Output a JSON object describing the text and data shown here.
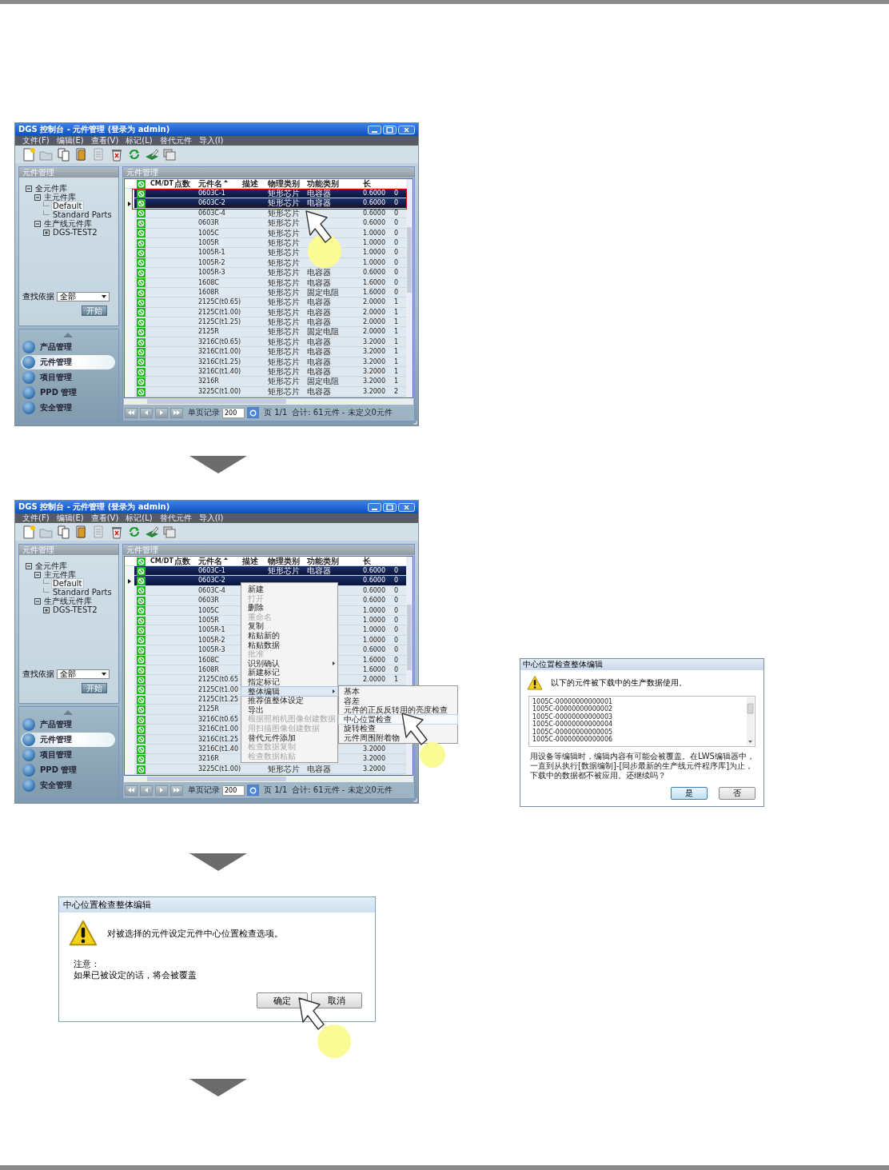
{
  "screens": [
    {
      "title": "DGS 控制台 - 元件管理 (登录为 admin)",
      "menu": [
        "文件(F)",
        "编辑(E)",
        "查看(V)",
        "标记(L)",
        "替代元件",
        "导入(I)"
      ],
      "left_panel": {
        "title": "元件管理",
        "tree": [
          {
            "label": "全元件库",
            "expanded": true,
            "selected": false,
            "children": [
              {
                "label": "主元件库",
                "expanded": true,
                "selected": false,
                "children": [
                  {
                    "label": "Default",
                    "selected": true
                  },
                  {
                    "label": "Standard Parts",
                    "selected": false
                  }
                ]
              },
              {
                "label": "生产线元件库",
                "expanded": true,
                "selected": false,
                "children": [
                  {
                    "label": "DGS-TEST2",
                    "expanded": false,
                    "selected": false
                  }
                ]
              }
            ]
          }
        ],
        "search_label": "查找依据",
        "search_value": "全部",
        "start_button": "开始",
        "nav": [
          {
            "label": "产品管理",
            "selected": false
          },
          {
            "label": "元件管理",
            "selected": true
          },
          {
            "label": "项目管理",
            "selected": false
          },
          {
            "label": "PPD 管理",
            "selected": false
          },
          {
            "label": "安全管理",
            "selected": false
          }
        ]
      },
      "table": {
        "title": "元件管理",
        "columns": [
          "CM/DT",
          "点数",
          "元件名",
          "描述",
          "物理类别",
          "功能类别",
          "长"
        ],
        "rows": [
          {
            "name": "0603C-1",
            "physical": "矩形芯片",
            "function": "电容器",
            "length": "0.6000",
            "column_9": "0",
            "selected": true,
            "current": false
          },
          {
            "name": "0603C-2",
            "physical": "矩形芯片",
            "function": "电容器",
            "length": "0.6000",
            "column_9": "0",
            "selected": true,
            "current": true
          },
          {
            "name": "0603C-4",
            "physical": "矩形芯片",
            "length": "0.6000",
            "column_9": "0",
            "selected": false,
            "current": false
          },
          {
            "name": "0603R",
            "physical": "矩形芯片",
            "length": "0.6000",
            "column_9": "0",
            "selected": false,
            "current": false
          },
          {
            "name": "1005C",
            "physical": "矩形芯片",
            "length": "1.0000",
            "column_9": "0",
            "selected": false,
            "current": false
          },
          {
            "name": "1005R",
            "physical": "矩形芯片",
            "length": "1.0000",
            "column_9": "0",
            "selected": false,
            "current": false
          },
          {
            "name": "1005R-1",
            "physical": "矩形芯片",
            "length": "1.0000",
            "column_9": "0",
            "selected": false,
            "current": false
          },
          {
            "name": "1005R-2",
            "physical": "矩形芯片",
            "length": "1.0000",
            "column_9": "0",
            "selected": false,
            "current": false
          },
          {
            "name": "1005R-3",
            "physical": "矩形芯片",
            "function": "电容器",
            "length": "0.6000",
            "column_9": "0",
            "selected": false,
            "current": false
          },
          {
            "name": "1608C",
            "physical": "矩形芯片",
            "function": "电容器",
            "length": "1.6000",
            "column_9": "0",
            "selected": false,
            "current": false
          },
          {
            "name": "1608R",
            "physical": "矩形芯片",
            "function": "固定电阻",
            "length": "1.6000",
            "column_9": "0",
            "selected": false,
            "current": false
          },
          {
            "name": "2125C(t0.65)",
            "physical": "矩形芯片",
            "function": "电容器",
            "length": "2.0000",
            "column_9": "1",
            "selected": false,
            "current": false
          },
          {
            "name": "2125C(t1.00)",
            "physical": "矩形芯片",
            "function": "电容器",
            "length": "2.0000",
            "column_9": "1",
            "selected": false,
            "current": false
          },
          {
            "name": "2125C(t1.25)",
            "physical": "矩形芯片",
            "function": "电容器",
            "length": "2.0000",
            "column_9": "1",
            "selected": false,
            "current": false
          },
          {
            "name": "2125R",
            "physical": "矩形芯片",
            "function": "固定电阻",
            "length": "2.0000",
            "column_9": "1",
            "selected": false,
            "current": false
          },
          {
            "name": "3216C(t0.65)",
            "physical": "矩形芯片",
            "function": "电容器",
            "length": "3.2000",
            "column_9": "1",
            "selected": false,
            "current": false
          },
          {
            "name": "3216C(t1.00)",
            "physical": "矩形芯片",
            "function": "电容器",
            "length": "3.2000",
            "column_9": "1",
            "selected": false,
            "current": false
          },
          {
            "name": "3216C(t1.25)",
            "physical": "矩形芯片",
            "function": "电容器",
            "length": "3.2000",
            "column_9": "1",
            "selected": false,
            "current": false
          },
          {
            "name": "3216C(t1.40)",
            "physical": "矩形芯片",
            "function": "电容器",
            "length": "3.2000",
            "column_9": "1",
            "selected": false,
            "current": false
          },
          {
            "name": "3216R",
            "physical": "矩形芯片",
            "function": "固定电阻",
            "length": "3.2000",
            "column_9": "1",
            "selected": false,
            "current": false
          },
          {
            "name": "3225C(t1.00)",
            "physical": "矩形芯片",
            "function": "电容器",
            "length": "3.2000",
            "column_9": "2",
            "selected": false,
            "current": false
          }
        ]
      },
      "pager": {
        "page_size_label": "单页记录",
        "page_size": "200",
        "page": "页 1/1",
        "total": "合计: 61元件 - 未定义0元件"
      }
    },
    {
      "title": "DGS 控制台 - 元件管理 (登录为 admin)",
      "menu": [
        "文件(F)",
        "编辑(E)",
        "查看(V)",
        "标记(L)",
        "替代元件",
        "导入(I)"
      ],
      "left_panel": {
        "title": "元件管理",
        "tree": [
          {
            "label": "全元件库",
            "expanded": true,
            "selected": false,
            "children": [
              {
                "label": "主元件库",
                "expanded": true,
                "selected": false,
                "children": [
                  {
                    "label": "Default",
                    "selected": true
                  },
                  {
                    "label": "Standard Parts",
                    "selected": false
                  }
                ]
              },
              {
                "label": "生产线元件库",
                "expanded": true,
                "selected": false,
                "children": [
                  {
                    "label": "DGS-TEST2",
                    "expanded": false,
                    "selected": false
                  }
                ]
              }
            ]
          }
        ],
        "search_label": "查找依据",
        "search_value": "全部",
        "start_button": "开始",
        "nav": [
          {
            "label": "产品管理",
            "selected": false
          },
          {
            "label": "元件管理",
            "selected": true
          },
          {
            "label": "项目管理",
            "selected": false
          },
          {
            "label": "PPD 管理",
            "selected": false
          },
          {
            "label": "安全管理",
            "selected": false
          }
        ]
      },
      "table": {
        "title": "元件管理",
        "columns": [
          "CM/DT",
          "点数",
          "元件名",
          "描述",
          "物理类别",
          "功能类别",
          "长"
        ],
        "rows": [
          {
            "name": "0603C-1",
            "physical": "矩形芯片",
            "function": "电容器",
            "length": "0.6000",
            "column_9": "0",
            "selected": true,
            "current": false
          },
          {
            "name": "0603C-2",
            "length": "0.6000",
            "column_9": "0",
            "selected": true,
            "current": true
          },
          {
            "name": "0603C-4",
            "length": "0.6000",
            "column_9": "0",
            "selected": false,
            "current": false
          },
          {
            "name": "0603R",
            "length": "0.6000",
            "column_9": "0",
            "selected": false,
            "current": false
          },
          {
            "name": "1005C",
            "length": "1.0000",
            "column_9": "0",
            "selected": false,
            "current": false
          },
          {
            "name": "1005R",
            "length": "1.0000",
            "column_9": "0",
            "selected": false,
            "current": false
          },
          {
            "name": "1005R-1",
            "length": "1.0000",
            "column_9": "0",
            "selected": false,
            "current": false
          },
          {
            "name": "1005R-2",
            "length": "1.0000",
            "column_9": "0",
            "selected": false,
            "current": false
          },
          {
            "name": "1005R-3",
            "length": "0.6000",
            "column_9": "0",
            "selected": false,
            "current": false
          },
          {
            "name": "1608C",
            "length": "1.6000",
            "column_9": "0",
            "selected": false,
            "current": false
          },
          {
            "name": "1608R",
            "length": "1.6000",
            "column_9": "0",
            "selected": false,
            "current": false
          },
          {
            "name": "2125C(t0.65",
            "length": "2.0000",
            "column_9": "1",
            "selected": false,
            "current": false
          },
          {
            "name": "2125C(t1.00",
            "selected": false,
            "current": false
          },
          {
            "name": "2125C(t1.25",
            "selected": false,
            "current": false
          },
          {
            "name": "2125R",
            "selected": false,
            "current": false
          },
          {
            "name": "3216C(t0.65",
            "selected": false,
            "current": false
          },
          {
            "name": "3216C(t1.00",
            "selected": false,
            "current": false
          },
          {
            "name": "3216C(t1.25",
            "selected": false,
            "current": false
          },
          {
            "name": "3216C(t1.40",
            "length": "3.2000",
            "selected": false,
            "current": false
          },
          {
            "name": "3216R",
            "length": "3.2000",
            "selected": false,
            "current": false
          },
          {
            "name": "3225C(t1.00)",
            "physical": "矩形芯片",
            "function": "电容器",
            "length": "3.2000",
            "selected": false,
            "current": false
          }
        ]
      },
      "pager": {
        "page_size_label": "单页记录",
        "page_size": "200",
        "page": "页 1/1",
        "total": "合计: 61元件 - 未定义0元件"
      },
      "context_menu": {
        "items": [
          {
            "label": "新建",
            "disabled": false,
            "has_submenu": false,
            "selected": false
          },
          {
            "label": "打开",
            "disabled": true,
            "has_submenu": false,
            "selected": false
          },
          {
            "label": "删除",
            "disabled": false,
            "has_submenu": false,
            "selected": false
          },
          {
            "label": "重命名",
            "disabled": true,
            "has_submenu": false,
            "selected": false
          },
          {
            "label": "复制",
            "disabled": false,
            "has_submenu": false,
            "selected": false
          },
          {
            "label": "粘贴新的",
            "disabled": false,
            "has_submenu": false,
            "selected": false
          },
          {
            "label": "粘贴数据",
            "disabled": false,
            "has_submenu": false,
            "selected": false
          },
          {
            "label": "批准",
            "disabled": true,
            "has_submenu": false,
            "selected": false
          },
          {
            "label": "识别确认",
            "disabled": false,
            "has_submenu": true,
            "selected": false
          },
          {
            "label": "新建标记",
            "disabled": false,
            "has_submenu": false,
            "selected": false
          },
          {
            "label": "指定标记",
            "disabled": false,
            "has_submenu": false,
            "selected": false
          },
          {
            "label": "整体编辑",
            "disabled": false,
            "has_submenu": true,
            "selected": true
          },
          {
            "label": "推荐值整体设定",
            "disabled": false,
            "has_submenu": false,
            "selected": false
          },
          {
            "label": "导出",
            "disabled": false,
            "has_submenu": false,
            "selected": false
          },
          {
            "label": "根据照相机图像创建数据",
            "disabled": true,
            "has_submenu": false,
            "selected": false
          },
          {
            "label": "用扫描图像创建数据",
            "disabled": true,
            "has_submenu": false,
            "selected": false
          },
          {
            "label": "替代元件添加",
            "disabled": false,
            "has_submenu": false,
            "selected": false
          },
          {
            "label": "检查数据复制",
            "disabled": true,
            "has_submenu": false,
            "selected": false
          },
          {
            "label": "检查数据粘贴",
            "disabled": true,
            "has_submenu": false,
            "selected": false
          }
        ],
        "submenu": [
          {
            "label": "基本",
            "selected": false
          },
          {
            "label": "容差",
            "selected": false
          },
          {
            "label": "元件的正反反转用的亮度检查",
            "selected": false
          },
          {
            "label": "中心位置检查",
            "selected": true
          },
          {
            "label": "旋转检查",
            "selected": false
          },
          {
            "label": "元件周围附着物",
            "selected": false
          }
        ]
      }
    }
  ],
  "confirm_dialog": {
    "title": "中心位置检查整体编辑",
    "message": "以下的元件被下载中的生产数据使用。",
    "list": [
      "1005C-00000000000001",
      "1005C-00000000000002",
      "1005C-00000000000003",
      "1005C-00000000000004",
      "1005C-00000000000005",
      "1005C-00000000000006"
    ],
    "text": "用设备等编辑时，编辑内容有可能会被覆盖。在LWS编辑器中，一直到从执行[数据编制]-[同步最新的生产线元件程序库]为止，下载中的数据都不被应用。还继续吗？",
    "buttons": [
      {
        "label": "是",
        "default": true
      },
      {
        "label": "否",
        "default": false
      }
    ]
  },
  "option_dialog": {
    "title": "中心位置检查整体编辑",
    "message": "对被选择的元件设定元件中心位置检查选项。",
    "note_label": "注意：",
    "note": "如果已被设定的话，将会被覆盖",
    "buttons": [
      {
        "label": "确定",
        "default": false
      },
      {
        "label": "取消",
        "default": false
      }
    ]
  }
}
